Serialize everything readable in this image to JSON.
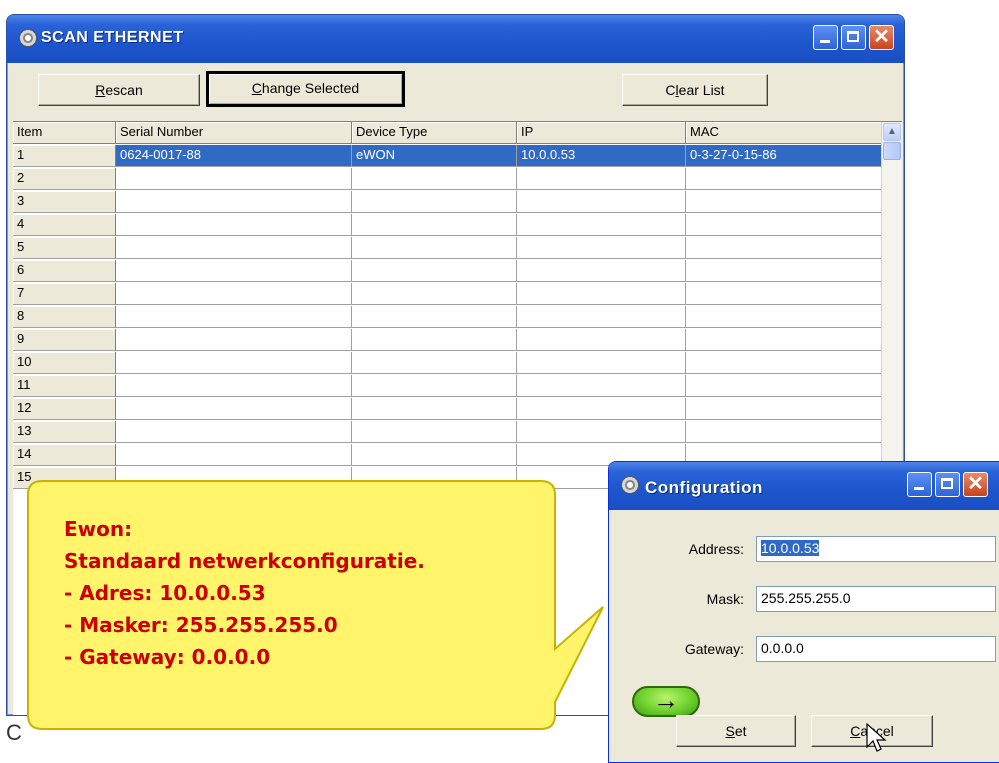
{
  "main_window": {
    "title": "SCAN ETHERNET",
    "buttons": {
      "rescan": "Rescan",
      "change_selected": "Change Selected",
      "clear_list": "Clear List"
    },
    "columns": [
      "Item",
      "Serial Number",
      "Device Type",
      "IP",
      "MAC"
    ],
    "rows": [
      {
        "item": "1",
        "serial": "0624-0017-88",
        "type": "eWON",
        "ip": "10.0.0.53",
        "mac": "0-3-27-0-15-86",
        "selected": true
      },
      {
        "item": "2"
      },
      {
        "item": "3"
      },
      {
        "item": "4"
      },
      {
        "item": "5"
      },
      {
        "item": "6"
      },
      {
        "item": "7"
      },
      {
        "item": "8"
      },
      {
        "item": "9"
      },
      {
        "item": "10"
      },
      {
        "item": "11"
      },
      {
        "item": "12"
      },
      {
        "item": "13"
      },
      {
        "item": "14"
      },
      {
        "item": "15"
      }
    ],
    "edge_letter": "C"
  },
  "config_dialog": {
    "title": "Configuration",
    "address_label": "Address:",
    "address_value": "10.0.0.53",
    "mask_label": "Mask:",
    "mask_value": "255.255.255.0",
    "gateway_label": "Gateway:",
    "gateway_value": "0.0.0.0",
    "arrow_glyph": "→",
    "set_button": "Set",
    "cancel_button": "Cancel"
  },
  "callout": {
    "lines": [
      "Ewon:",
      "Standaard netwerkconfiguratie.",
      "- Adres: 10.0.0.53",
      "- Masker: 255.255.255.0",
      "- Gateway: 0.0.0.0"
    ],
    "line_colors": [
      "#cc0000",
      "#cc0000",
      "#cc0000",
      "#cc0000",
      "#cc0000"
    ],
    "fill": "#fff46a",
    "stroke": "#c9b200"
  },
  "colors": {
    "selection": "#316ac5",
    "titlebar": "#1d55cc",
    "window_face": "#ece9d8"
  }
}
